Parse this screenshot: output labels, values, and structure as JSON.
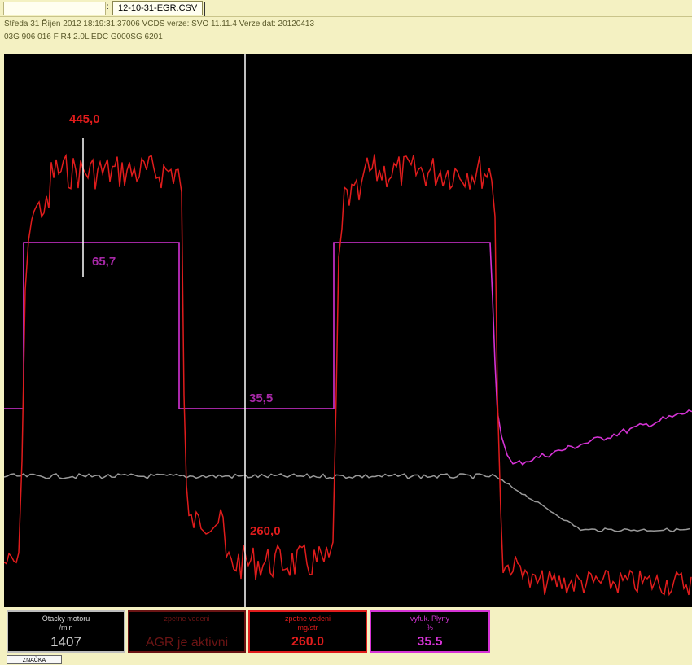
{
  "tabs": {
    "blank_label": "",
    "separator": ":",
    "file_label": "12-10-31-EGR.CSV"
  },
  "info": {
    "line1": "Středa 31 Říjen 2012 18:19:31:37006 VCDS verze: SVO 11.11.4 Verze dat: 20120413",
    "line2": "03G 906 016 F  R4 2.0L EDC G000SG  6201"
  },
  "colors": {
    "rpm": "#9a9a9a",
    "egr": "#e01c1c",
    "exhaust": "#d533d5",
    "agr_status": "#6a1414",
    "cursor": "#ffffff"
  },
  "labels": {
    "egr_peak": "445,0",
    "exhaust_high": "65,7",
    "exhaust_cursor": "35,5",
    "egr_cursor": "260,0"
  },
  "panels": {
    "rpm": {
      "name": "Otacky motoru",
      "unit": "/min",
      "value": "1407"
    },
    "agr": {
      "name": "zpetne vedeni",
      "unit": "",
      "value": "AGR je aktivni"
    },
    "egr": {
      "name": "zpetne vedeni",
      "unit": "mg/str",
      "value": "260.0"
    },
    "gas": {
      "name": "vyfuk. Plyny",
      "unit": "%",
      "value": "35.5"
    }
  },
  "marker_button": "ZNAČKA",
  "chart_data": {
    "type": "line",
    "title": "",
    "series": [
      {
        "name": "Otacky motoru",
        "unit": "/min",
        "cursor_value": 1407
      },
      {
        "name": "zpetne vedeni",
        "unit": "mg/str",
        "cursor_value": 260.0,
        "marked_value": 445.0
      },
      {
        "name": "vyfuk. Plyny",
        "unit": "%",
        "cursor_value": 35.5,
        "marked_value": 65.7
      }
    ],
    "grid": false
  }
}
